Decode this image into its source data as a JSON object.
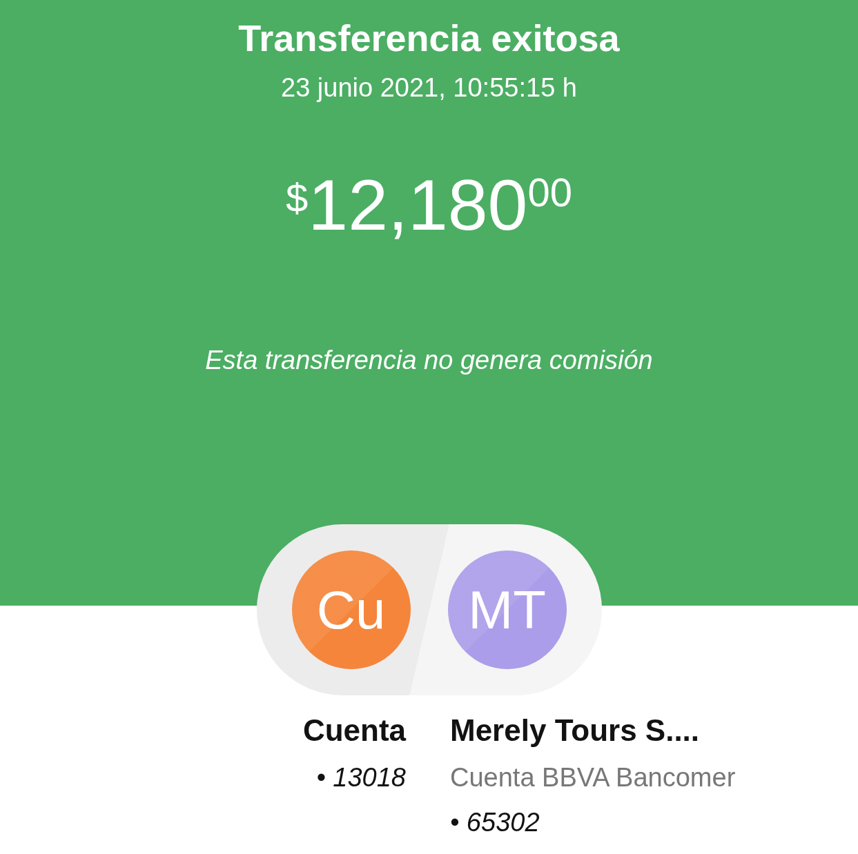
{
  "header": {
    "title": "Transferencia exitosa",
    "datetime": "23 junio 2021, 10:55:15 h",
    "amount": {
      "currency": "$",
      "integer": "12,180",
      "cents": "00"
    },
    "note": "Esta transferencia no genera comisión"
  },
  "parties": [
    {
      "initials": "Cu",
      "color": "#f5853a",
      "name": "Cuenta",
      "lines": [
        {
          "kind": "account",
          "text": "• 13018"
        }
      ]
    },
    {
      "initials": "MT",
      "color": "#ab9de9",
      "name": "Merely Tours S....",
      "lines": [
        {
          "kind": "bank",
          "text": "Cuenta BBVA Bancomer"
        },
        {
          "kind": "account",
          "text": "• 65302"
        }
      ]
    }
  ]
}
